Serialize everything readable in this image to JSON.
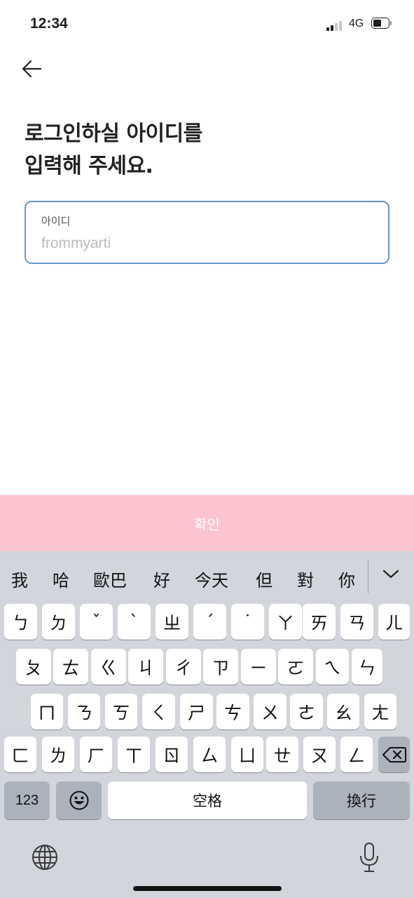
{
  "status_bar": {
    "time": "12:34",
    "network": "4G"
  },
  "header": {
    "title_line1": "로그인하실 아이디를",
    "title_line2": "입력해 주세요."
  },
  "id_field": {
    "label": "아이디",
    "value": "",
    "placeholder": "frommyarti"
  },
  "confirm_button": {
    "label": "확인"
  },
  "keyboard": {
    "candidates": [
      "我",
      "哈",
      "歐巴",
      "好",
      "今天",
      "但",
      "對",
      "你"
    ],
    "row1": [
      "ㄅ",
      "ㄉ",
      "ˇ",
      "ˋ",
      "ㄓ",
      "ˊ",
      "˙",
      "ㄚ",
      "ㄞ",
      "ㄢ",
      "ㄦ"
    ],
    "row2": [
      "ㄆ",
      "ㄊ",
      "ㄍ",
      "ㄐ",
      "ㄔ",
      "ㄗ",
      "ㄧ",
      "ㄛ",
      "ㄟ",
      "ㄣ"
    ],
    "row3": [
      "ㄇ",
      "ㄋ",
      "ㄎ",
      "ㄑ",
      "ㄕ",
      "ㄘ",
      "ㄨ",
      "ㄜ",
      "ㄠ",
      "ㄤ"
    ],
    "row4": [
      "ㄈ",
      "ㄌ",
      "ㄏ",
      "ㄒ",
      "ㄖ",
      "ㄙ",
      "ㄩ",
      "ㄝ",
      "ㄡ",
      "ㄥ"
    ],
    "numbers_key": "123",
    "space_key": "空格",
    "return_key": "換行"
  }
}
